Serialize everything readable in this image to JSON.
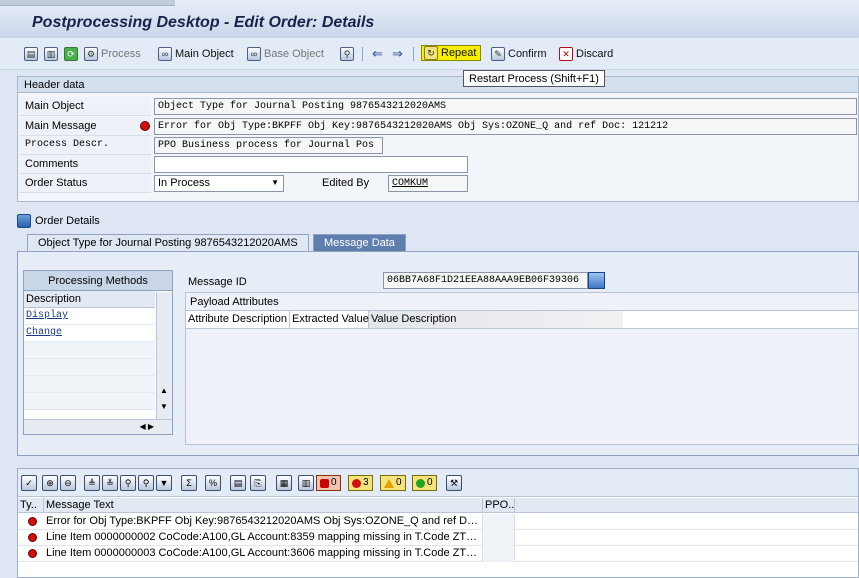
{
  "window": {
    "title": "Postprocessing Desktop - Edit Order: Details"
  },
  "toolbar": {
    "process_label": "Process",
    "main_object_label": "Main Object",
    "base_object_label": "Base Object",
    "repeat_label": "Repeat",
    "confirm_label": "Confirm",
    "discard_label": "Discard",
    "tooltip": "Restart Process   (Shift+F1)"
  },
  "header": {
    "title": "Header data",
    "main_object_label": "Main Object",
    "main_object_value": "Object Type for Journal Posting 9876543212020AMS",
    "main_message_label": "Main Message",
    "main_message_value": "Error for Obj Type:BKPFF Obj Key:9876543212020AMS Obj Sys:OZONE_Q and ref Doc: 121212",
    "process_descr_label": "Process Descr.",
    "process_descr_value": "PPO Business process for Journal Pos",
    "comments_label": "Comments",
    "comments_value": "",
    "order_status_label": "Order Status",
    "order_status_value": "In Process",
    "edited_by_label": "Edited By",
    "edited_by_value": "COMKUM"
  },
  "order_details": {
    "label": "Order Details"
  },
  "tabs": [
    {
      "label": "Object Type for Journal Posting 9876543212020AMS"
    },
    {
      "label": "Message Data"
    }
  ],
  "processing_methods": {
    "title": "Processing Methods",
    "column": "Description",
    "items": [
      "Display",
      "Change"
    ]
  },
  "message_data": {
    "message_id_label": "Message ID",
    "message_id_value": "06BB7A68F1D21EEA88AAA9EB06F39306",
    "payload_title": "Payload Attributes",
    "columns": [
      "Attribute Description",
      "Extracted Value",
      "Value Description"
    ]
  },
  "messages": {
    "counts": {
      "stop": "0",
      "error": "3",
      "warning": "0",
      "success": "0"
    },
    "columns": [
      "Ty..",
      "Message Text",
      "PPO.."
    ],
    "rows": [
      {
        "text": "Error for Obj Type:BKPFF Obj Key:9876543212020AMS Obj Sys:OZONE_Q and ref Doc: ..."
      },
      {
        "text": "Line Item 0000000002 CoCode:A100,GL Account:8359 mapping missing in T.Code ZTC..."
      },
      {
        "text": "Line Item 0000000003 CoCode:A100,GL Account:3606 mapping missing in T.Code ZTC..."
      }
    ]
  }
}
